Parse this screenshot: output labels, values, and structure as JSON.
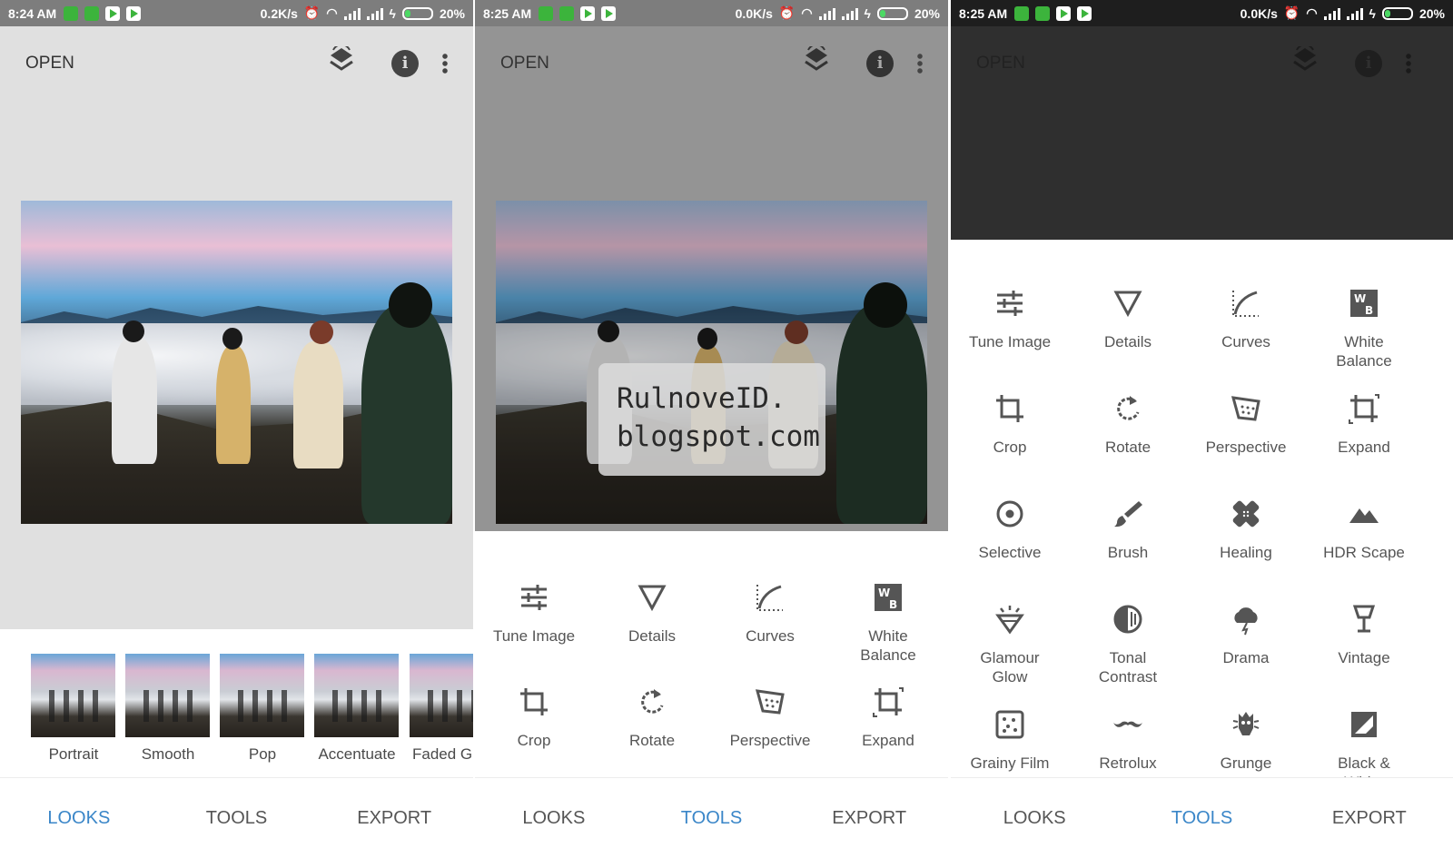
{
  "status_bars": [
    {
      "time": "8:24 AM",
      "speed": "0.2K/s",
      "battery": "20%"
    },
    {
      "time": "8:25 AM",
      "speed": "0.0K/s",
      "battery": "20%"
    },
    {
      "time": "8:25 AM",
      "speed": "0.0K/s",
      "battery": "20%"
    }
  ],
  "appbar": {
    "open_label": "OPEN",
    "info_glyph": "i"
  },
  "watermark": {
    "line1": "RulnoveID.",
    "line2": "blogspot.com"
  },
  "looks": [
    "Portrait",
    "Smooth",
    "Pop",
    "Accentuate",
    "Faded Gl"
  ],
  "nav": {
    "looks": "LOOKS",
    "tools": "TOOLS",
    "export": "EXPORT"
  },
  "tools_s2": [
    {
      "label": "Tune Image",
      "icon": "tune-icon"
    },
    {
      "label": "Details",
      "icon": "details-icon"
    },
    {
      "label": "Curves",
      "icon": "curves-icon"
    },
    {
      "label": "White\nBalance",
      "icon": "white-balance-icon"
    },
    {
      "label": "Crop",
      "icon": "crop-icon"
    },
    {
      "label": "Rotate",
      "icon": "rotate-icon"
    },
    {
      "label": "Perspective",
      "icon": "perspective-icon"
    },
    {
      "label": "Expand",
      "icon": "expand-icon"
    }
  ],
  "tools_s3": [
    {
      "label": "Tune Image",
      "icon": "tune-icon"
    },
    {
      "label": "Details",
      "icon": "details-icon"
    },
    {
      "label": "Curves",
      "icon": "curves-icon"
    },
    {
      "label": "White\nBalance",
      "icon": "white-balance-icon"
    },
    {
      "label": "Crop",
      "icon": "crop-icon"
    },
    {
      "label": "Rotate",
      "icon": "rotate-icon"
    },
    {
      "label": "Perspective",
      "icon": "perspective-icon"
    },
    {
      "label": "Expand",
      "icon": "expand-icon"
    },
    {
      "label": "Selective",
      "icon": "selective-icon"
    },
    {
      "label": "Brush",
      "icon": "brush-icon"
    },
    {
      "label": "Healing",
      "icon": "healing-icon"
    },
    {
      "label": "HDR Scape",
      "icon": "hdr-scape-icon"
    },
    {
      "label": "Glamour\nGlow",
      "icon": "glamour-glow-icon"
    },
    {
      "label": "Tonal\nContrast",
      "icon": "tonal-contrast-icon"
    },
    {
      "label": "Drama",
      "icon": "drama-icon"
    },
    {
      "label": "Vintage",
      "icon": "vintage-icon"
    },
    {
      "label": "Grainy Film",
      "icon": "grainy-film-icon"
    },
    {
      "label": "Retrolux",
      "icon": "retrolux-icon"
    },
    {
      "label": "Grunge",
      "icon": "grunge-icon"
    },
    {
      "label": "Black &\nWhite",
      "icon": "black-white-icon"
    }
  ],
  "colors": {
    "accent": "#3a86c8",
    "status_bar": "#7d7d7d",
    "panel_bg": "#e0e0e0"
  }
}
